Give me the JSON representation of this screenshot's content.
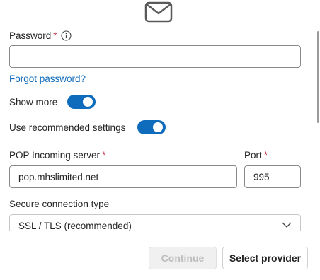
{
  "icons": {
    "mail": "mail-icon",
    "info": "info-icon",
    "chevron": "chevron-down-icon"
  },
  "password": {
    "label": "Password",
    "required_mark": "*",
    "value": ""
  },
  "forgot_password": "Forgot password?",
  "show_more": {
    "label": "Show more",
    "on": true
  },
  "use_recommended": {
    "label": "Use recommended settings",
    "on": true
  },
  "pop_server": {
    "label": "POP Incoming server",
    "required_mark": "*",
    "value": "pop.mhslimited.net"
  },
  "port": {
    "label": "Port",
    "required_mark": "*",
    "value": "995"
  },
  "secure_connection": {
    "label": "Secure connection type",
    "selected": "SSL / TLS (recommended)"
  },
  "buttons": {
    "continue": "Continue",
    "select_provider": "Select provider"
  },
  "colors": {
    "accent": "#0f6cbd",
    "required": "#c4314b",
    "disabled_text": "#bdbdbd"
  }
}
